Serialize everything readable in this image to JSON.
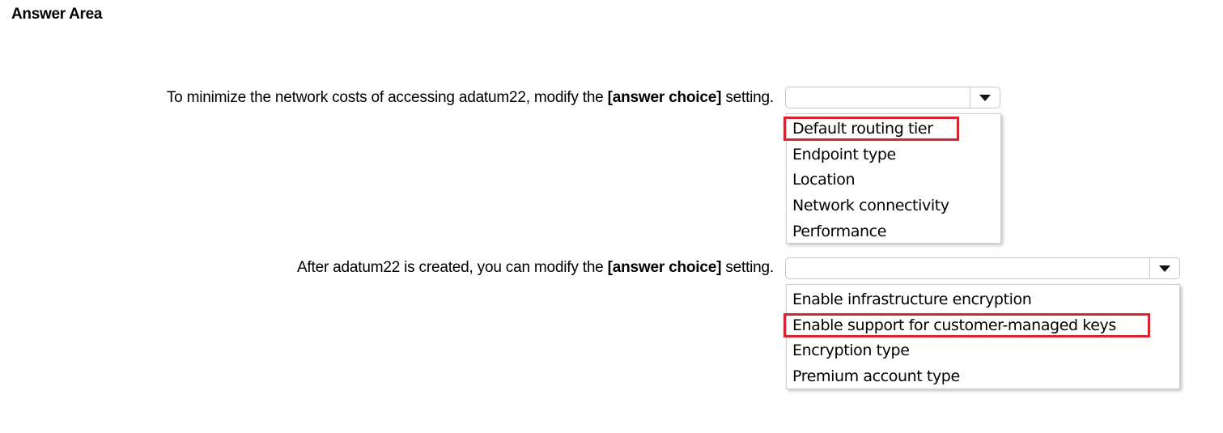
{
  "title": "Answer Area",
  "questions": [
    {
      "prefix": "To minimize the network costs of accessing adatum22, modify the ",
      "emphasis": "[answer choice]",
      "suffix": " setting.",
      "selected_value": "",
      "options": [
        "Default routing tier",
        "Endpoint type",
        "Location",
        "Network connectivity",
        "Performance"
      ],
      "highlighted_index": 0
    },
    {
      "prefix": "After adatum22 is created, you can modify the ",
      "emphasis": "[answer choice]",
      "suffix": " setting.",
      "selected_value": "",
      "options": [
        "Enable infrastructure encryption",
        "Enable support for customer-managed keys",
        "Encryption type",
        "Premium account type"
      ],
      "highlighted_index": 1
    }
  ],
  "colors": {
    "highlight_border": "#d9232e",
    "dropdown_border": "#c8c8c8"
  },
  "icons": {
    "dropdown_arrow": "chevron-down-icon"
  }
}
